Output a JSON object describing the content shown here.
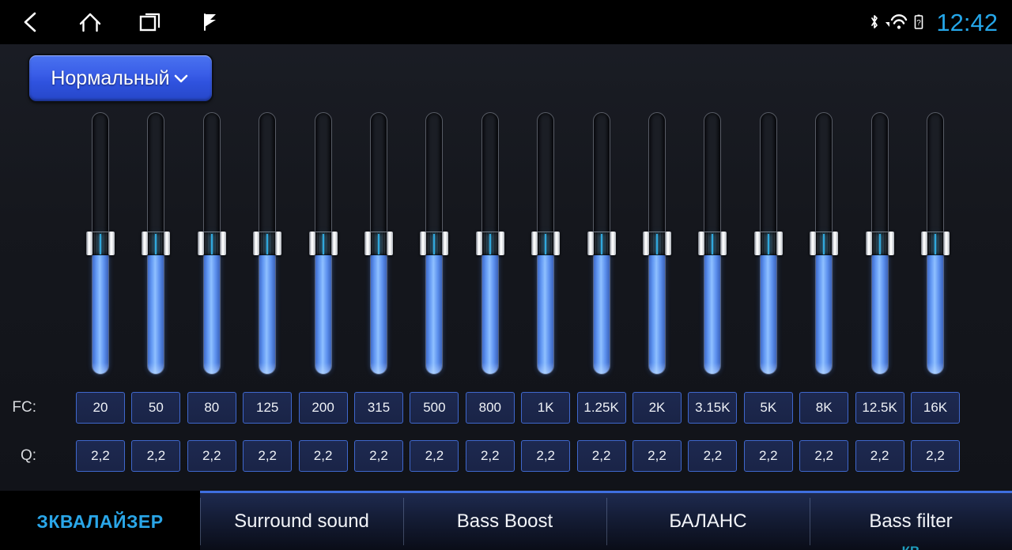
{
  "statusbar": {
    "nav": [
      {
        "name": "back-icon",
        "label": "Back"
      },
      {
        "name": "home-icon",
        "label": "Home"
      },
      {
        "name": "recents-icon",
        "label": "Recents"
      },
      {
        "name": "flag-cursor-icon",
        "label": "Flag"
      }
    ],
    "indicators": [
      {
        "name": "bluetooth-icon",
        "label": "Bluetooth"
      },
      {
        "name": "wifi-icon",
        "label": "Wi-Fi"
      },
      {
        "name": "battery-unknown-icon",
        "label": "Battery unknown"
      }
    ],
    "clock": "12:42",
    "clock_color": "#25a6e8"
  },
  "preset": {
    "label": "Нормальный",
    "chevron": "chevron-down-icon",
    "accent": "#3a5ee8"
  },
  "equalizer": {
    "bands": 16,
    "row_labels": {
      "fc": "FC:",
      "q": "Q:"
    },
    "fc_values": [
      "20",
      "50",
      "80",
      "125",
      "200",
      "315",
      "500",
      "800",
      "1K",
      "1.25K",
      "2K",
      "3.15K",
      "5K",
      "8K",
      "12.5K",
      "16K"
    ],
    "q_values": [
      "2,2",
      "2,2",
      "2,2",
      "2,2",
      "2,2",
      "2,2",
      "2,2",
      "2,2",
      "2,2",
      "2,2",
      "2,2",
      "2,2",
      "2,2",
      "2,2",
      "2,2",
      "2,2"
    ],
    "slider_positions": [
      50,
      50,
      50,
      50,
      50,
      50,
      50,
      50,
      50,
      50,
      50,
      50,
      50,
      50,
      50,
      50
    ],
    "fill_color": "#6fa4f5",
    "track_border": "#585c66"
  },
  "tabs": [
    {
      "label": "ЗКВАЛАЙЗЕР",
      "active": true
    },
    {
      "label": "Surround sound",
      "active": false
    },
    {
      "label": "Bass Boost",
      "active": false
    },
    {
      "label": "БАЛАНС",
      "active": false
    },
    {
      "label": "Bass filter",
      "active": false
    }
  ]
}
